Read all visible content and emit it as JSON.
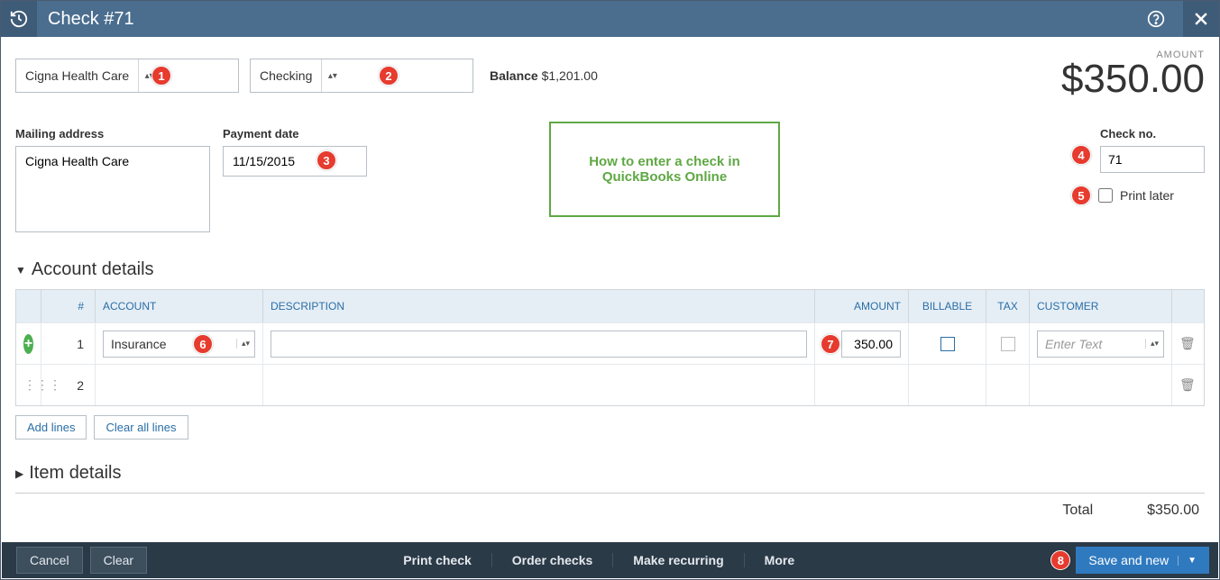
{
  "header": {
    "title": "Check #71"
  },
  "payee": {
    "value": "Cigna Health Care"
  },
  "bank_account": {
    "value": "Checking"
  },
  "balance": {
    "label": "Balance",
    "value": "$1,201.00"
  },
  "amount_header": {
    "label": "AMOUNT",
    "value": "$350.00"
  },
  "mailing": {
    "label": "Mailing address",
    "value": "Cigna Health Care"
  },
  "payment_date": {
    "label": "Payment date",
    "value": "11/15/2015"
  },
  "callout": {
    "line1": "How to enter a check in",
    "line2": "QuickBooks Online"
  },
  "check_no": {
    "label": "Check no.",
    "value": "71"
  },
  "print_later": {
    "label": "Print later"
  },
  "account_details": {
    "title": "Account details",
    "columns": {
      "num": "#",
      "account": "ACCOUNT",
      "description": "DESCRIPTION",
      "amount": "AMOUNT",
      "billable": "BILLABLE",
      "tax": "TAX",
      "customer": "CUSTOMER"
    },
    "rows": [
      {
        "num": "1",
        "account": "Insurance",
        "description": "",
        "amount": "350.00",
        "customer_placeholder": "Enter Text"
      },
      {
        "num": "2",
        "account": "",
        "description": "",
        "amount": "",
        "customer_placeholder": ""
      }
    ],
    "add_lines": "Add lines",
    "clear_lines": "Clear all lines"
  },
  "item_details": {
    "title": "Item details"
  },
  "total": {
    "label": "Total",
    "value": "$350.00"
  },
  "bottombar": {
    "cancel": "Cancel",
    "clear": "Clear",
    "print_check": "Print check",
    "order_checks": "Order checks",
    "make_recurring": "Make recurring",
    "more": "More",
    "save": "Save and new"
  },
  "badges": {
    "b1": "1",
    "b2": "2",
    "b3": "3",
    "b4": "4",
    "b5": "5",
    "b6": "6",
    "b7": "7",
    "b8": "8"
  }
}
